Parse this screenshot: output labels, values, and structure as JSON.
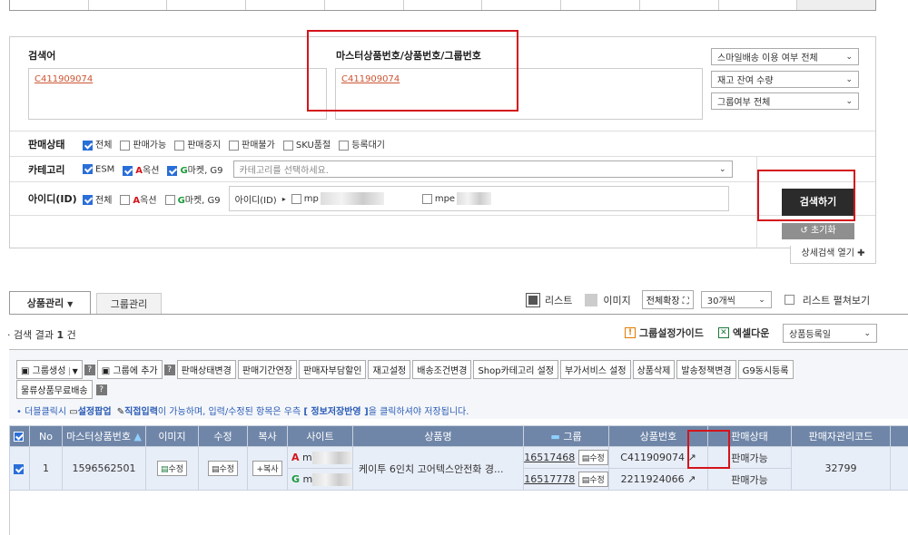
{
  "top_row": [
    "",
    "",
    "",
    "",
    "",
    "",
    "",
    "",
    "",
    "",
    ""
  ],
  "search": {
    "keyword_label": "검색어",
    "keyword_value": "C411909074",
    "master_label": "마스터상품번호/상품번호/그룹번호",
    "master_value": "C411909074",
    "dropdowns": [
      "스마일배송 이용 여부 전체",
      "재고 잔여 수량",
      "그룹여부 전체"
    ]
  },
  "status_row": {
    "label": "판매상태",
    "options": [
      {
        "label": "전체",
        "checked": true
      },
      {
        "label": "판매가능",
        "checked": false
      },
      {
        "label": "판매중지",
        "checked": false
      },
      {
        "label": "판매불가",
        "checked": false
      },
      {
        "label": "SKU품절",
        "checked": false
      },
      {
        "label": "등록대기",
        "checked": false
      }
    ]
  },
  "category_row": {
    "label": "카테고리",
    "esm": "ESM",
    "auction": "옥션",
    "auction_mark": "A",
    "gmarket": "마켓, G9",
    "gmarket_mark": "G",
    "placeholder": "카테고리를 선택하세요."
  },
  "id_row": {
    "label": "아이디(ID)",
    "all": "전체",
    "auction": "옥션",
    "auction_mark": "A",
    "gmarket": "마켓, G9",
    "gmarket_mark": "G",
    "id_label": "아이디(ID)",
    "id1": "mp",
    "id2": "mpe"
  },
  "buttons": {
    "search": "검색하기",
    "reset": "초기화",
    "detail": "상세검색 열기"
  },
  "tabs": [
    "상품관리",
    "그룹관리"
  ],
  "view": {
    "list": "리스트",
    "image": "이미지",
    "expand": "전체확장",
    "count": "30개씩",
    "unfold": "리스트 펼쳐보기"
  },
  "result": {
    "text": "검색 결과",
    "count": "1",
    "unit": "건"
  },
  "tools": {
    "guide": "그룹설정가이드",
    "excel": "엑셀다운",
    "sort": "상품등록일"
  },
  "action_buttons": [
    "판매상태변경",
    "판매기간연장",
    "판매자부담할인",
    "재고설정",
    "배송조건변경",
    "Shop카테고리 설정",
    "부가서비스 설정",
    "상품삭제",
    "발송정책변경",
    "G9동시등록"
  ],
  "group_create": "그룹생성",
  "group_add": "그룹에 추가",
  "free_ship": "물류상품무료배송",
  "notice": {
    "prefix": "• 더블클릭시",
    "setting": "설정팝업",
    "direct": "직접입력",
    "mid": "이 가능하며, 입력/수정된 항목은 우측",
    "save": "[ 정보저장반영 ]",
    "suffix": "을 클릭하셔야 저장됩니다."
  },
  "table": {
    "headers": [
      "No",
      "마스터상품번호",
      "이미지",
      "수정",
      "복사",
      "사이트",
      "상품명",
      "그룹",
      "상품번호",
      "판매상태",
      "판매자관리코드"
    ],
    "row": {
      "no": "1",
      "master": "1596562501",
      "image_btn": "수정",
      "edit_btn": "수정",
      "copy_btn": "복사",
      "site_a": "A",
      "site_a_id": "m",
      "site_g": "G",
      "site_g_id": "m",
      "name": "케이투 6인치 고어텍스안전화 경...",
      "group1": "16517468",
      "group2": "16517778",
      "group_btn": "수정",
      "prod1": "C411909074",
      "prod2": "2211924066",
      "status1": "판매가능",
      "status2": "판매가능",
      "code": "32799"
    }
  }
}
